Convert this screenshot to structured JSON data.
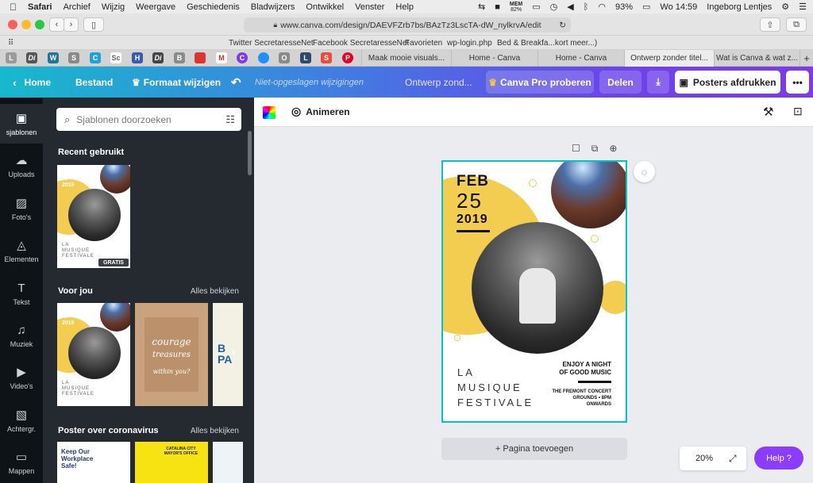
{
  "menubar": {
    "app": "Safari",
    "items": [
      "Archief",
      "Wijzig",
      "Weergave",
      "Geschiedenis",
      "Bladwijzers",
      "Ontwikkel",
      "Venster",
      "Help"
    ],
    "mem_label": "MEM",
    "mem_value": "82%",
    "battery": "93%",
    "clock": "Wo 14:59",
    "user": "Ingeborg Lentjes"
  },
  "toolbar": {
    "url": "www.canva.com/design/DAEVFZrb7bs/BAzTz3LscTA-dW_nylkrvA/edit"
  },
  "favorites": [
    "Twitter SecretaresseNet",
    "Facebook SecretaresseNet",
    "Favorieten",
    "wp-login.php",
    "Bed & Breakfa...kort meer...)"
  ],
  "tabs": {
    "pinned": [
      "L",
      "Di",
      "W",
      "S",
      "C",
      "Sc",
      "H",
      "Di",
      "B",
      "",
      "M",
      "C",
      "",
      "O",
      "L",
      "S",
      "P"
    ],
    "items": [
      "Maak mooie visuals...",
      "Home - Canva",
      "Home - Canva",
      "Ontwerp zonder titel...",
      "Wat is Canva & wat z..."
    ]
  },
  "canva_header": {
    "home": "Home",
    "file": "Bestand",
    "resize": "Formaat wijzigen",
    "status": "Niet-opgeslagen wijzigingen",
    "title": "Ontwerp zond...",
    "pro": "Canva Pro proberen",
    "share": "Delen",
    "print": "Posters afdrukken",
    "more": "•••"
  },
  "rail": [
    {
      "label": "sjablonen",
      "icon": "▣"
    },
    {
      "label": "Uploads",
      "icon": "☁"
    },
    {
      "label": "Foto's",
      "icon": "▨"
    },
    {
      "label": "Elementen",
      "icon": "◬"
    },
    {
      "label": "Tekst",
      "icon": "T"
    },
    {
      "label": "Muziek",
      "icon": "♫"
    },
    {
      "label": "Video's",
      "icon": "▶"
    },
    {
      "label": "Achtergr.",
      "icon": "▧"
    },
    {
      "label": "Mappen",
      "icon": "▭"
    }
  ],
  "panel": {
    "search_placeholder": "Sjablonen doorzoeken",
    "recent": "Recent gebruikt",
    "for_you": "Voor jou",
    "see_all": "Alles bekijken",
    "corona": "Poster over coronavirus",
    "free_badge": "GRATIS",
    "thumb_courage": [
      "courage",
      "treasures",
      "within you?"
    ],
    "thumb_workplace": "Keep Our Workplace Safe!",
    "thumb_catalina": "CATALINA CITY MAYOR'S OFFICE"
  },
  "editor": {
    "animate": "Animeren",
    "add_page": "+ Pagina toevoegen",
    "zoom": "20%",
    "help": "Help  ?"
  },
  "poster": {
    "month": "FEB",
    "day": "25",
    "year": "2019",
    "title_lines": [
      "LA",
      "MUSIQUE",
      "FESTIVALE"
    ],
    "tagline": [
      "ENJOY A NIGHT",
      "OF GOOD MUSIC"
    ],
    "venue": [
      "THE FREMONT CONCERT",
      "GROUNDS • 8PM",
      "ONWARDS"
    ],
    "accent": "#f2cd4f"
  }
}
